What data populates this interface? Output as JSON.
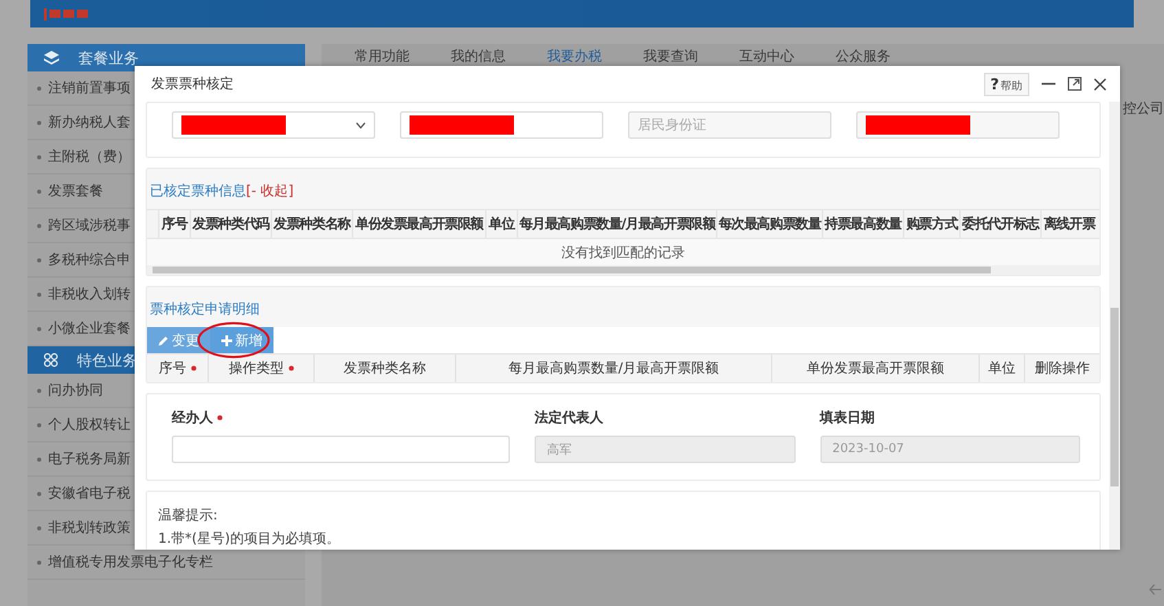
{
  "nav_tabs": [
    {
      "label": "常用功能",
      "selected": false
    },
    {
      "label": "我的信息",
      "selected": false
    },
    {
      "label": "我要办税",
      "selected": true
    },
    {
      "label": "我要查询",
      "selected": false
    },
    {
      "label": "互动中心",
      "selected": false
    },
    {
      "label": "公众服务",
      "selected": false
    }
  ],
  "sidebar": {
    "sections": [
      {
        "title": "套餐业务",
        "kind": "stack",
        "items": [
          "注销前置事项",
          "新办纳税人套",
          "主附税（费）",
          "发票套餐",
          "跨区域涉税事",
          "多税种综合申",
          "非税收入划转",
          "小微企业套餐"
        ]
      },
      {
        "title": "特色业务",
        "kind": "cluster",
        "items": [
          "问办协同",
          "个人股权转让",
          "电子税务局新",
          "安徽省电子税",
          "非税划转政策",
          "增值税专用发票电子化专栏"
        ]
      }
    ]
  },
  "side_note": "控公司",
  "dialog": {
    "title": "发票票种核定",
    "help_icon": "?",
    "help": "帮助",
    "fields": [
      {
        "kind": "select",
        "redacted": true
      },
      {
        "kind": "input",
        "redacted": true
      },
      {
        "kind": "input",
        "placeholder": "居民身份证"
      },
      {
        "kind": "input",
        "redacted": true
      }
    ],
    "issued_section": {
      "title": "已核定票种信息",
      "toggle": "[- 收起]",
      "columns": [
        "序号",
        "发票种类代码",
        "发票种类名称",
        "单份发票最高开票限额",
        "单位",
        "每月最高购票数量/月最高开票限额",
        "每次最高购票数量",
        "持票最高数量",
        "购票方式",
        "委托代开标志",
        "离线开票"
      ],
      "empty_message": "没有找到匹配的记录"
    },
    "apply_section": {
      "title": "票种核定申请明细",
      "buttons": [
        {
          "label": "变更",
          "kind": "edit",
          "highlighted": false
        },
        {
          "label": "新增",
          "kind": "add",
          "highlighted": true
        }
      ],
      "columns": [
        {
          "label": "序号",
          "required": true
        },
        {
          "label": "操作类型",
          "required": true
        },
        {
          "label": "发票种类名称",
          "required": false
        },
        {
          "label": "每月最高购票数量/月最高开票限额",
          "required": false
        },
        {
          "label": "单份发票最高开票限额",
          "required": false
        },
        {
          "label": "单位",
          "required": false
        },
        {
          "label": "删除操作",
          "required": false
        }
      ]
    },
    "form": [
      {
        "label": "经办人",
        "required": true,
        "disabled": false
      },
      {
        "label": "法定代表人",
        "required": false,
        "value": "高军",
        "disabled": true
      },
      {
        "label": "填表日期",
        "required": false,
        "value": "2023-10-07",
        "disabled": true
      }
    ],
    "tips": {
      "title": "温馨提示:",
      "lines": [
        "1.带*(星号)的项目为必填项。"
      ]
    }
  }
}
